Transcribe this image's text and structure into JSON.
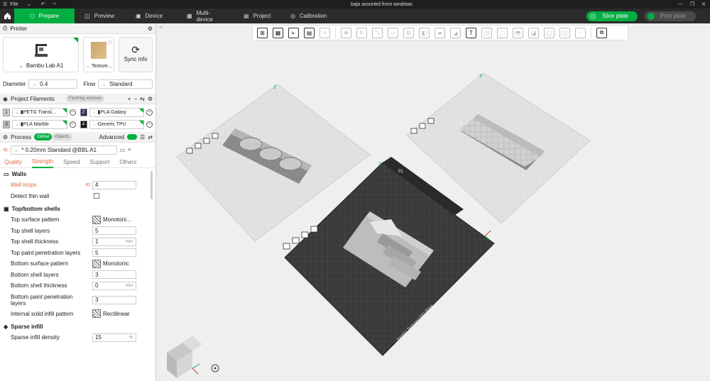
{
  "titlebar": {
    "menu": "File",
    "title": "baja assorted front windows"
  },
  "nav": {
    "tabs": [
      "Prepare",
      "Preview",
      "Device",
      "Multi-device",
      "Project",
      "Calibration"
    ],
    "slice": "Slice plate",
    "print": "Print plate"
  },
  "printer": {
    "header": "Printer",
    "name": "Bambu Lab A1",
    "plate": "Texture...",
    "sync": "Sync info",
    "diameter_label": "Diameter",
    "diameter": "0.4",
    "flow_label": "Flow",
    "flow": "Standard"
  },
  "filaments": {
    "header": "Project Filaments",
    "flushing": "Flushing volumes",
    "items": [
      {
        "num": "1",
        "name": "PETG Transl...",
        "color": "#cfcfcf"
      },
      {
        "num": "2",
        "name": "PLA Galaxy",
        "color": "#2a2a55"
      },
      {
        "num": "3",
        "name": "PLA Marble",
        "color": "#bdbdbd"
      },
      {
        "num": "4",
        "name": "Generic TPU",
        "color": "#111111"
      }
    ]
  },
  "process": {
    "header": "Process",
    "global": "Global",
    "objects": "Objects",
    "advanced": "Advanced",
    "preset": "* 0.20mm Standard @BBL A1",
    "tabs": [
      "Quality",
      "Strength",
      "Speed",
      "Support",
      "Others"
    ]
  },
  "settings": {
    "walls": "Walls",
    "wall_loops": "Wall loops",
    "wall_loops_val": "4",
    "detect_thin": "Detect thin wall",
    "topbottom": "Top/bottom shells",
    "top_pattern": "Top surface pattern",
    "top_pattern_val": "Monotoni...",
    "top_layers": "Top shell layers",
    "top_layers_val": "5",
    "top_thick": "Top shell thickness",
    "top_thick_val": "1",
    "top_paint": "Top paint penetration layers",
    "top_paint_val": "5",
    "bottom_pattern": "Bottom surface pattern",
    "bottom_pattern_val": "Monotonic",
    "bottom_layers": "Bottom shell layers",
    "bottom_layers_val": "3",
    "bottom_thick": "Bottom shell thickness",
    "bottom_thick_val": "0",
    "bottom_paint": "Bottom paint penetration layers",
    "bottom_paint_val": "3",
    "internal_pattern": "Internal solid infill pattern",
    "internal_pattern_val": "Rectilinear",
    "sparse": "Sparse infill",
    "sparse_density": "Sparse infill density",
    "sparse_density_val": "15",
    "unit_mm": "mm",
    "unit_pct": "%"
  },
  "plates": {
    "plate_label": "Bambu Textured PEI Plate",
    "numbers": [
      "2",
      "3",
      "1"
    ],
    "active_number": "01"
  }
}
